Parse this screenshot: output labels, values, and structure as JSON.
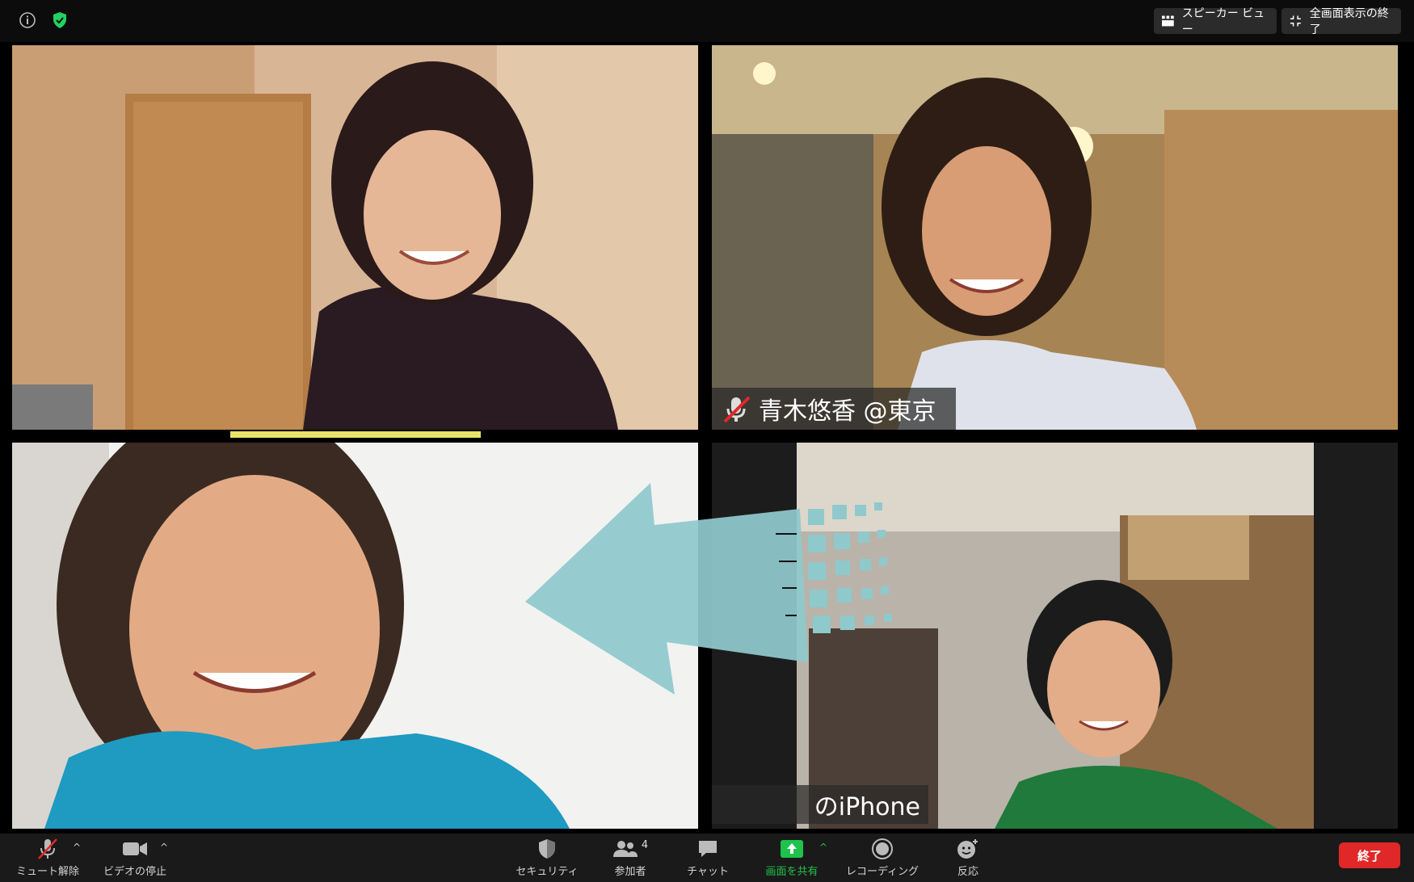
{
  "topbar": {
    "speaker_view_label": "スピーカー ビュー",
    "exit_fullscreen_label": "全画面表示の終了"
  },
  "participants": [
    {
      "name": "",
      "muted": false,
      "speaking": true
    },
    {
      "name": "青木悠香 @東京",
      "muted": true,
      "speaking": false
    },
    {
      "name": "",
      "muted": false,
      "speaking": false
    },
    {
      "name": "のiPhone",
      "muted": false,
      "speaking": false
    }
  ],
  "toolbar": {
    "mute_label": "ミュート解除",
    "video_label": "ビデオの停止",
    "security_label": "セキュリティ",
    "participants_label": "参加者",
    "participants_count": "4",
    "chat_label": "チャット",
    "share_label": "画面を共有",
    "record_label": "レコーディング",
    "reactions_label": "反応",
    "end_label": "終了"
  },
  "colors": {
    "accent_green": "#23d160",
    "share_green": "#1fc24b",
    "end_red": "#e02828",
    "speaker_highlight": "#e8e26a",
    "overlay_arrow": "#8fc9cc"
  }
}
